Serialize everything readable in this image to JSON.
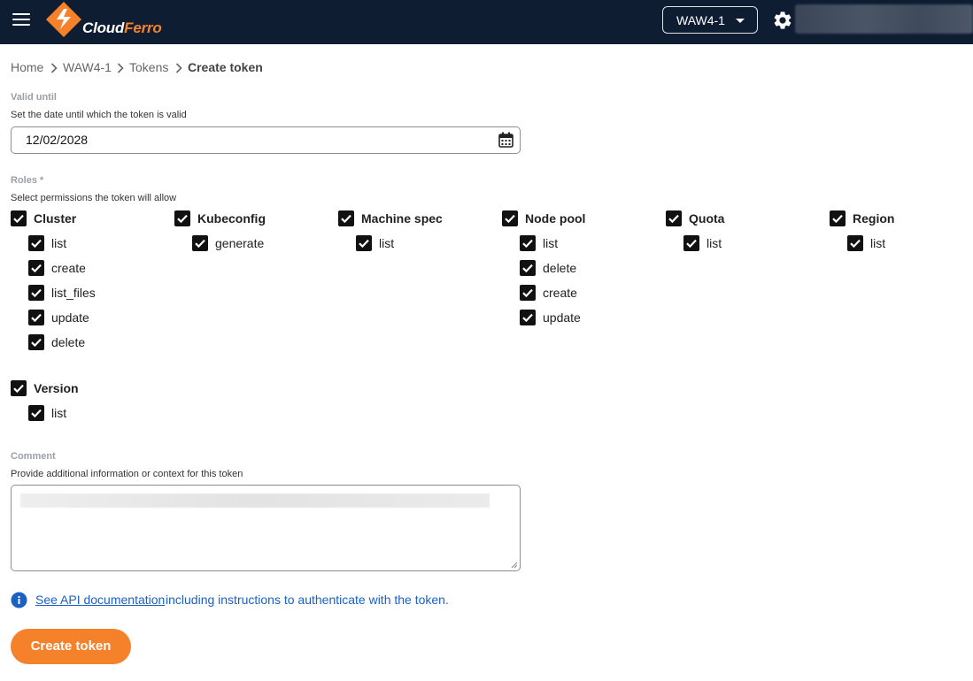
{
  "header": {
    "logo_text_1": "Cloud",
    "logo_text_2": "Ferro",
    "region": "WAW4-1",
    "brand_color": "#f5812a",
    "bar_color": "#0f1d33"
  },
  "breadcrumb": [
    "Home",
    "WAW4-1",
    "Tokens",
    "Create token"
  ],
  "valid_until": {
    "label": "Valid until",
    "hint": "Set the date until which the token is valid",
    "value": "12/02/2028"
  },
  "roles": {
    "label": "Roles *",
    "hint": "Select permissions the token will allow",
    "groups": [
      {
        "name": "Cluster",
        "checked": true,
        "perms": [
          "list",
          "create",
          "list_files",
          "update",
          "delete"
        ]
      },
      {
        "name": "Kubeconfig",
        "checked": true,
        "perms": [
          "generate"
        ]
      },
      {
        "name": "Machine spec",
        "checked": true,
        "perms": [
          "list"
        ]
      },
      {
        "name": "Node pool",
        "checked": true,
        "perms": [
          "list",
          "delete",
          "create",
          "update"
        ]
      },
      {
        "name": "Quota",
        "checked": true,
        "perms": [
          "list"
        ]
      },
      {
        "name": "Region",
        "checked": true,
        "perms": [
          "list"
        ]
      },
      {
        "name": "Version",
        "checked": true,
        "perms": [
          "list"
        ]
      }
    ]
  },
  "comment": {
    "label": "Comment",
    "hint": "Provide additional information or context for this token"
  },
  "info": {
    "link": "See API documentation",
    "text": "including instructions to authenticate with the token."
  },
  "create_button": "Create token"
}
